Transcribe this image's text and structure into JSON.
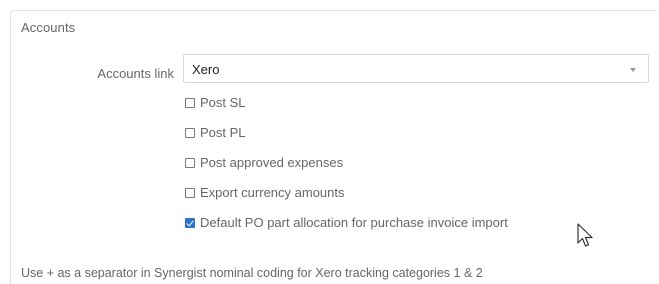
{
  "section": {
    "title": "Accounts",
    "accounts_link": {
      "label": "Accounts link",
      "value": "Xero"
    },
    "options": [
      {
        "label": "Post SL",
        "checked": false
      },
      {
        "label": "Post PL",
        "checked": false
      },
      {
        "label": "Post approved expenses",
        "checked": false
      },
      {
        "label": "Export currency amounts",
        "checked": false
      },
      {
        "label": "Default PO part allocation for purchase invoice import",
        "checked": true
      }
    ],
    "note": "Use + as a separator in Synergist nominal coding for Xero tracking categories 1 & 2"
  },
  "colors": {
    "accent": "#2a73c9",
    "border": "#e3e3e3",
    "text": "#666666"
  },
  "icons": {
    "dropdown": "caret-down-icon",
    "pointer": "mouse-pointer-icon"
  }
}
